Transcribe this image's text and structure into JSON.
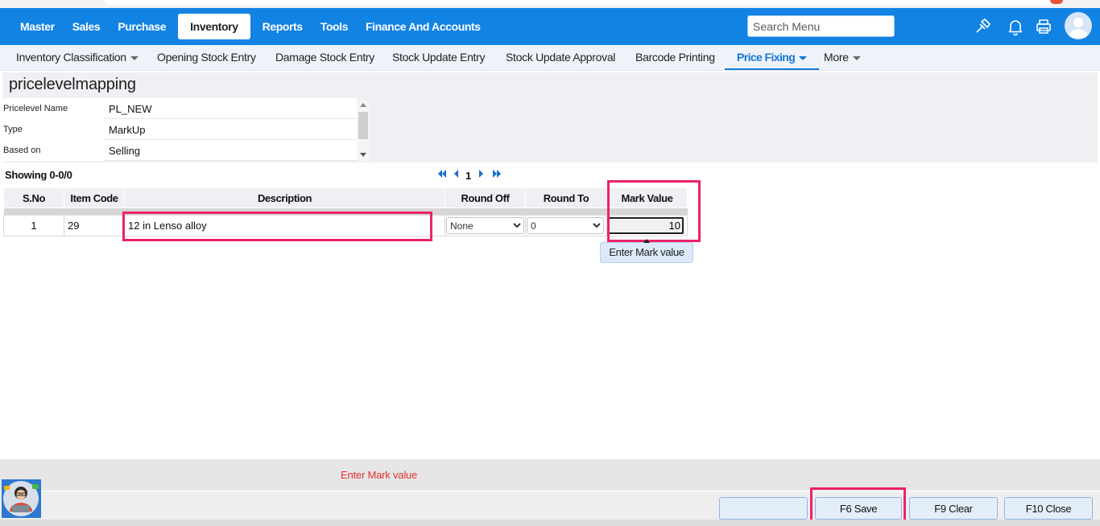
{
  "navbar": {
    "menu": [
      "Master",
      "Sales",
      "Purchase",
      "Inventory",
      "Reports",
      "Tools",
      "Finance And Accounts"
    ],
    "active_index": 3,
    "search_placeholder": "Search Menu",
    "icons": [
      "hammer-icon",
      "bell-icon",
      "printer-icon",
      "user-avatar-icon"
    ]
  },
  "subnav": {
    "items": [
      {
        "label": "Inventory Classification",
        "dropdown": true
      },
      {
        "label": "Opening Stock Entry",
        "dropdown": false
      },
      {
        "label": "Damage Stock Entry",
        "dropdown": false
      },
      {
        "label": "Stock Update Entry",
        "dropdown": false
      },
      {
        "label": "Stock Update Approval",
        "dropdown": false
      },
      {
        "label": "Barcode Printing",
        "dropdown": false
      },
      {
        "label": "Price Fixing",
        "dropdown": true,
        "active": true
      },
      {
        "label": "More",
        "dropdown": true
      }
    ]
  },
  "page": {
    "title": "pricelevelmapping"
  },
  "form": {
    "pricelevel_name_label": "Pricelevel Name",
    "pricelevel_name_value": "PL_NEW",
    "type_label": "Type",
    "type_value": "MarkUp",
    "based_on_label": "Based on",
    "based_on_value": "Selling"
  },
  "list": {
    "showing": "Showing 0-0/0",
    "page_number": "1"
  },
  "table": {
    "headers": {
      "sno": "S.No",
      "item_code": "Item Code",
      "description": "Description",
      "round_off": "Round Off",
      "round_to": "Round To",
      "mark_value": "Mark Value"
    },
    "rows": [
      {
        "sno": "1",
        "item_code": "29",
        "description": "12 in Lenso alloy",
        "round_off": "None",
        "round_to": "0",
        "mark_value": "10"
      }
    ]
  },
  "tooltip": "Enter Mark value",
  "status": {
    "message": "Enter Mark value",
    "message_color": "#e53030"
  },
  "footer": {
    "blank_label": "",
    "save_label": "F6 Save",
    "clear_label": "F9 Clear",
    "close_label": "F10 Close"
  },
  "colors": {
    "navbar": "#1283e3",
    "accent": "#1577d6",
    "highlight": "#ee2266"
  }
}
